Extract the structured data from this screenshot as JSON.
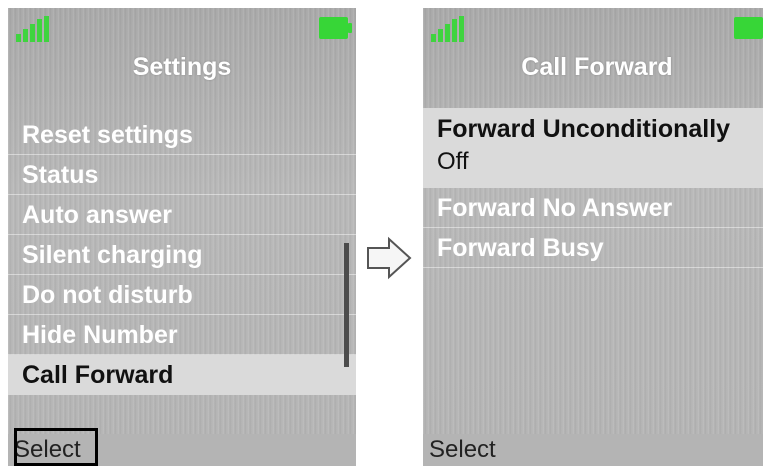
{
  "left_screen": {
    "title": "Settings",
    "items": [
      {
        "label": "Reset settings"
      },
      {
        "label": "Status"
      },
      {
        "label": "Auto answer"
      },
      {
        "label": "Silent charging"
      },
      {
        "label": "Do not disturb"
      },
      {
        "label": "Hide Number"
      },
      {
        "label": "Call Forward",
        "selected": true
      }
    ],
    "softkey": "Select"
  },
  "right_screen": {
    "title": "Call Forward",
    "items": [
      {
        "label": "Forward Unconditionally",
        "value": "Off",
        "selected": true
      },
      {
        "label": "Forward No Answer"
      },
      {
        "label": "Forward Busy"
      }
    ],
    "softkey": "Select"
  },
  "colors": {
    "signal": "#3fd43f",
    "battery": "#37d637",
    "highlight": "#dadada",
    "menu_text": "#ffffff"
  },
  "icons": [
    "signal-strength-icon",
    "battery-icon",
    "right-arrow-icon"
  ]
}
